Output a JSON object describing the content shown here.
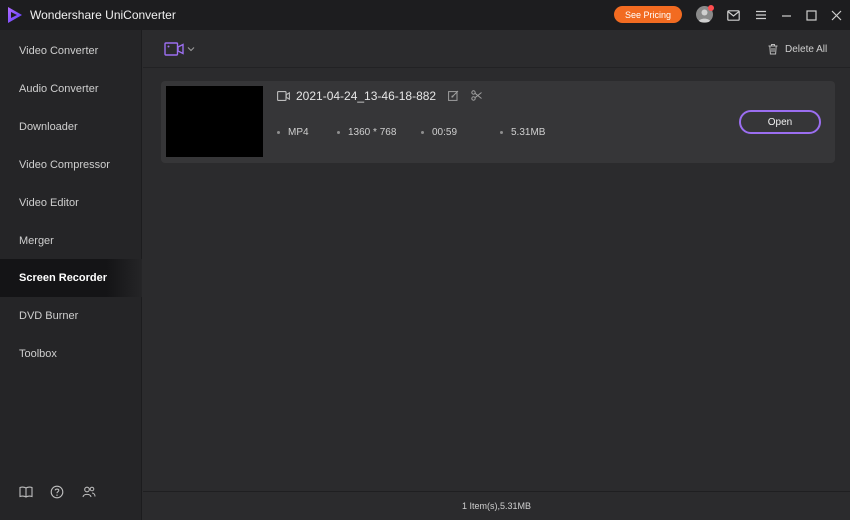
{
  "app": {
    "title": "Wondershare UniConverter"
  },
  "titlebar": {
    "pricing_label": "See Pricing",
    "brand_color": "#f26b21"
  },
  "sidebar": {
    "items": [
      {
        "label": "Video Converter"
      },
      {
        "label": "Audio Converter"
      },
      {
        "label": "Downloader"
      },
      {
        "label": "Video Compressor"
      },
      {
        "label": "Video Editor"
      },
      {
        "label": "Merger"
      },
      {
        "label": "Screen Recorder",
        "active": true
      },
      {
        "label": "DVD Burner"
      },
      {
        "label": "Toolbox"
      }
    ],
    "footer_icons": [
      "book-icon",
      "help-icon",
      "community-icon"
    ]
  },
  "toolbar": {
    "delete_all_label": "Delete All",
    "accent_color": "#9b6ef0"
  },
  "file": {
    "name": "2021-04-24_13-46-18-882",
    "format": "MP4",
    "resolution": "1360 * 768",
    "duration": "00:59",
    "size": "5.31MB",
    "open_label": "Open"
  },
  "status": {
    "summary": "1 Item(s),5.31MB"
  }
}
